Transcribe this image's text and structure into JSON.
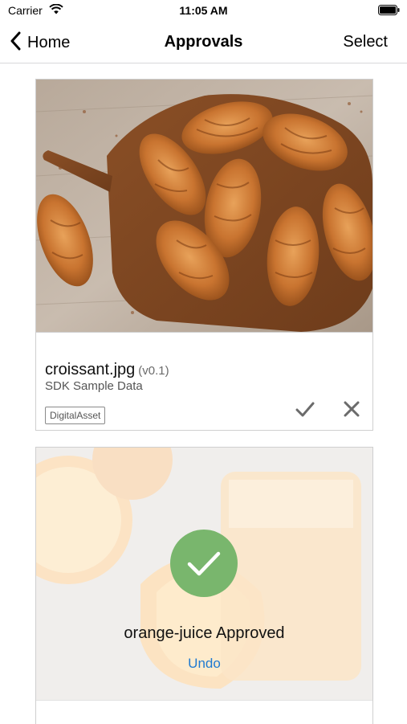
{
  "status_bar": {
    "carrier": "Carrier",
    "time": "11:05 AM"
  },
  "nav": {
    "back_label": "Home",
    "title": "Approvals",
    "select_label": "Select"
  },
  "cards": [
    {
      "name": "croissant.jpg",
      "version": "(v0.1)",
      "subtitle": "SDK Sample Data",
      "tag": "DigitalAsset",
      "image": "croissants-on-board-photo"
    },
    {
      "image": "orange-juice-photo",
      "status_message": "orange-juice Approved",
      "undo_label": "Undo",
      "accent_color": "#79b66d"
    }
  ],
  "colors": {
    "link": "#1f7ad1",
    "approved": "#79b66d"
  }
}
